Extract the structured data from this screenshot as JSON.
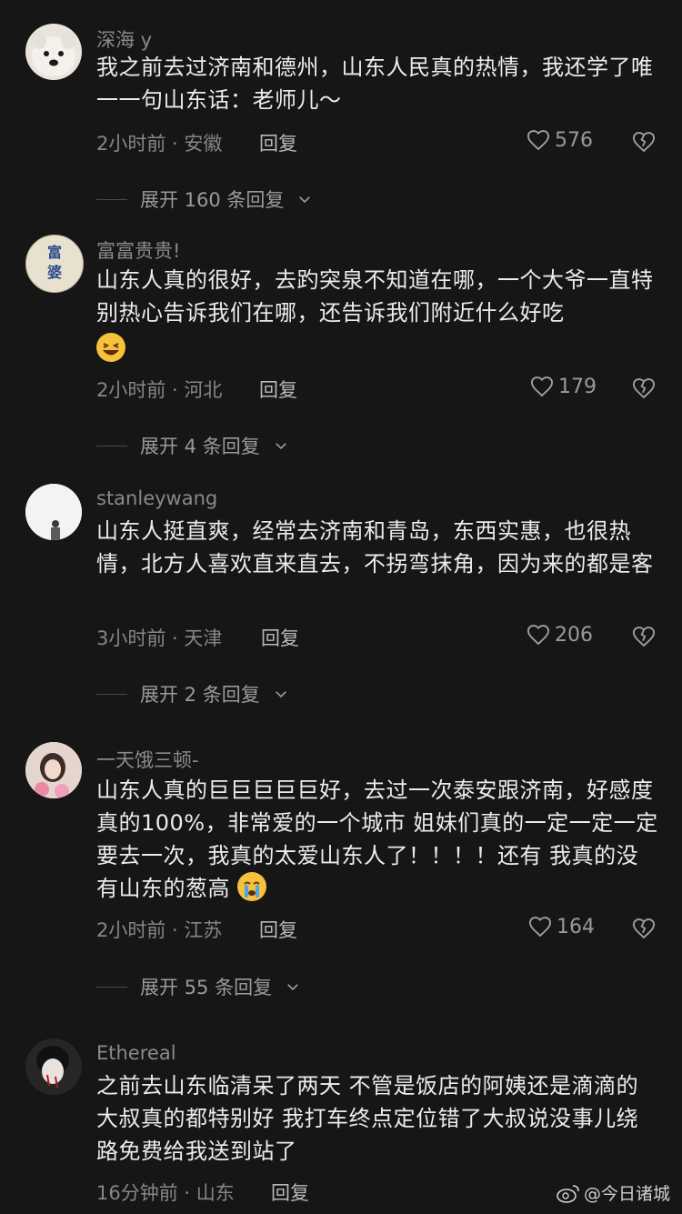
{
  "comments": [
    {
      "username": "深海 y",
      "text": "我之前去过济南和德州，山东人民真的热情，我还学了唯一一句山东话：老师儿～",
      "meta": "2小时前 · 安徽",
      "reply": "回复",
      "likes": "576",
      "expand": "展开 160 条回复"
    },
    {
      "username": "富富贵贵!",
      "text": "山东人真的很好，去趵突泉不知道在哪，一个大爷一直特别热心告诉我们在哪，还告诉我们附近什么好吃",
      "meta": "2小时前 · 河北",
      "reply": "回复",
      "likes": "179",
      "expand": "展开 4 条回复"
    },
    {
      "username": "stanleywang",
      "text": "山东人挺直爽，经常去济南和青岛，东西实惠，也很热情，北方人喜欢直来直去，不拐弯抹角，因为来的都是客",
      "meta": "3小时前 · 天津",
      "reply": "回复",
      "likes": "206",
      "expand": "展开 2 条回复"
    },
    {
      "username": "一天饿三顿-",
      "text": "山东人真的巨巨巨巨巨好，去过一次泰安跟济南，好感度真的100%，非常爱的一个城市 姐妹们真的一定一定一定要去一次，我真的太爱山东人了！！！！还有 我真的没有山东的葱高",
      "meta": "2小时前 · 江苏",
      "reply": "回复",
      "likes": "164",
      "expand": "展开 55 条回复"
    },
    {
      "username": "Ethereal",
      "text": "之前去山东临清呆了两天 不管是饭店的阿姨还是滴滴的大叔真的都特别好 我打车终点定位错了大叔说没事儿绕路免费给我送到站了",
      "meta": "16分钟前 · 山东",
      "reply": "回复"
    }
  ],
  "avatar_1_text": "富婆",
  "watermark": "@今日诸城",
  "colors": {
    "background": "#161616",
    "text": "#ececec",
    "muted": "#8a8a8a"
  }
}
